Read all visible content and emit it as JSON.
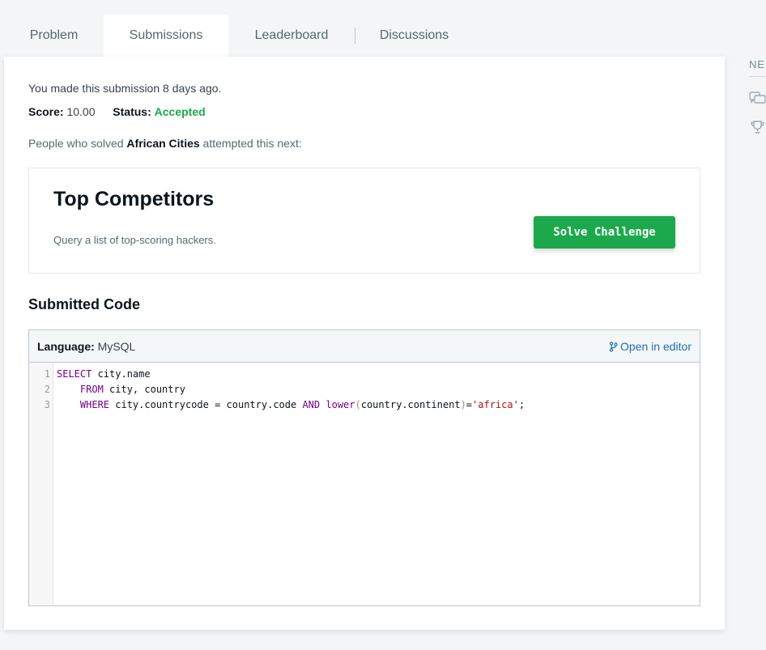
{
  "tabs": [
    {
      "label": "Problem"
    },
    {
      "label": "Submissions"
    },
    {
      "label": "Leaderboard"
    },
    {
      "label": "Discussions"
    }
  ],
  "submission": {
    "made_text": "You made this submission 8 days ago.",
    "score_label": "Score:",
    "score_value": "10.00",
    "status_label": "Status:",
    "status_value": "Accepted",
    "solved_prefix": "People who solved ",
    "solved_challenge": "African Cities",
    "solved_suffix": " attempted this next:"
  },
  "next_challenge": {
    "title": "Top Competitors",
    "description": "Query a list of top-scoring hackers.",
    "button_label": "Solve Challenge"
  },
  "code_section": {
    "title": "Submitted Code",
    "language_label": "Language:",
    "language_value": "MySQL",
    "open_editor_label": "Open in editor",
    "line_numbers": [
      "1",
      "2",
      "3"
    ]
  },
  "sidebar": {
    "heading_fragment": "NE",
    "icons": [
      "discussion-icon",
      "trophy-icon"
    ]
  },
  "colors": {
    "accent_green": "#1ba94c",
    "link_blue": "#1f6fb5"
  }
}
